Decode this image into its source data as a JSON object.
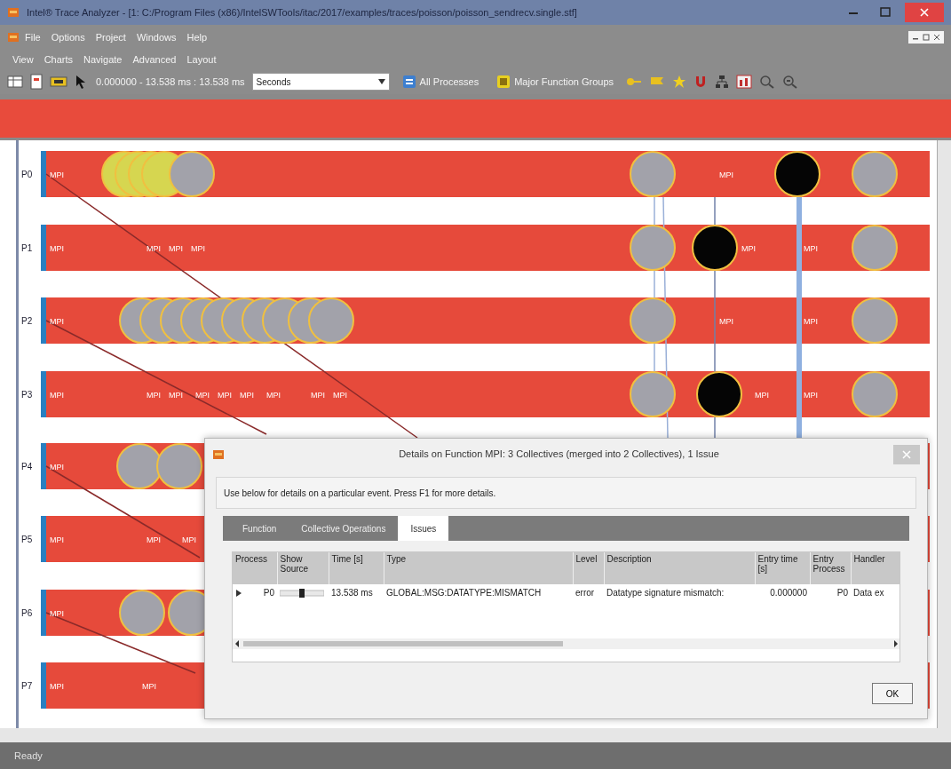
{
  "window": {
    "title": "Intel® Trace Analyzer - [1: C:/Program Files (x86)/IntelSWTools/itac/2017/examples/traces/poisson/poisson_sendrecv.single.stf]"
  },
  "menu": [
    "File",
    "Options",
    "Project",
    "Windows",
    "Help"
  ],
  "chart_menu": [
    "View",
    "Charts",
    "Navigate",
    "Advanced",
    "Layout"
  ],
  "toolbar": {
    "time_range": "0.000000 - 13.538 ms : 13.538 ms",
    "time_unit": "Seconds",
    "process_button": "All Processes",
    "group_button": "Major Function Groups"
  },
  "processes": [
    {
      "label": "P0",
      "labels": [
        "MPI",
        "MPI"
      ]
    },
    {
      "label": "P1",
      "labels": [
        "MPI",
        "MPI",
        "MPI",
        "MPI",
        "MPI",
        "MPI"
      ]
    },
    {
      "label": "P2",
      "labels": [
        "MPI",
        "MPI",
        "MPI"
      ]
    },
    {
      "label": "P3",
      "labels": [
        "MPI",
        "MPI",
        "MPI",
        "MPI",
        "MPI",
        "MPI",
        "MPI",
        "MPI",
        "MPI",
        "MPI",
        "MPI"
      ]
    },
    {
      "label": "P4",
      "labels": [
        "MPI"
      ]
    },
    {
      "label": "P5",
      "labels": [
        "MPI",
        "MPI",
        "MPI"
      ]
    },
    {
      "label": "P6",
      "labels": [
        "MPI"
      ]
    },
    {
      "label": "P7",
      "labels": [
        "MPI",
        "MPI"
      ]
    }
  ],
  "dialog": {
    "title": "Details on Function MPI: 3 Collectives (merged into 2 Collectives), 1 Issue",
    "hint": "Use below for details on a particular event. Press F1 for more details.",
    "tabs": [
      {
        "label": "Function",
        "selected": false
      },
      {
        "label": "Collective Operations",
        "selected": false
      },
      {
        "label": "Issues",
        "selected": true
      }
    ],
    "table": {
      "columns": [
        "Process",
        "Show Source",
        "Time [s]",
        "Type",
        "Level",
        "Description",
        "Entry time [s]",
        "Entry Process",
        "Handler"
      ],
      "rows": [
        {
          "expanded": false,
          "process": "P0",
          "time": "13.538 ms",
          "type": "GLOBAL:MSG:DATATYPE:MISMATCH",
          "level": "error",
          "description": "Datatype signature mismatch:",
          "entry_time": "0.000000",
          "entry_process": "P0",
          "handler": "Data ex"
        }
      ]
    },
    "ok": "OK"
  },
  "status_bar": "Ready"
}
